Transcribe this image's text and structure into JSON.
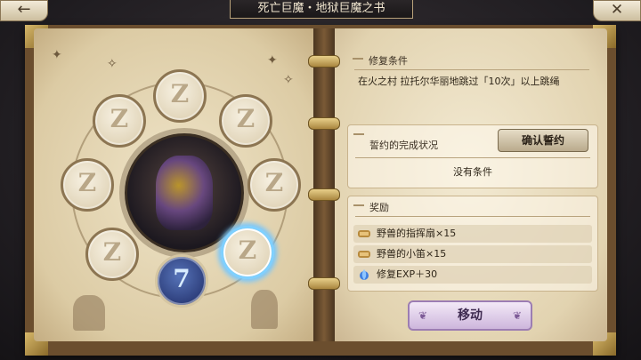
{
  "header": {
    "title": "死亡巨魔・地狱巨魔之书",
    "back_icon": "←",
    "close_icon": "✕"
  },
  "seals": [
    {
      "glyph": "Z",
      "state": "locked"
    },
    {
      "glyph": "Z",
      "state": "locked"
    },
    {
      "glyph": "Z",
      "state": "locked"
    },
    {
      "glyph": "Z",
      "state": "locked"
    },
    {
      "glyph": "Z",
      "state": "locked"
    },
    {
      "glyph": "Z",
      "state": "locked"
    },
    {
      "glyph": "Z",
      "state": "selected"
    },
    {
      "glyph": "7",
      "state": "active"
    }
  ],
  "repair": {
    "title": "修复条件",
    "text": "在火之村 拉托尔华丽地跳过「10次」以上跳绳"
  },
  "oath": {
    "title": "誓约的完成状况",
    "confirm_label": "确认誓约",
    "status": "没有条件"
  },
  "rewards": {
    "title": "奖励",
    "items": [
      {
        "label": "野兽的指挥扇×15",
        "icon": "scroll-icon"
      },
      {
        "label": "野兽的小笛×15",
        "icon": "scroll-icon"
      },
      {
        "label": "修复EXP＋30",
        "icon": "blue-flame-icon"
      }
    ]
  },
  "move_button": {
    "label": "移动"
  },
  "colors": {
    "selected_glow": "#73c6ff",
    "move_button": "#cdb6dc",
    "page": "#e2d3b0"
  }
}
